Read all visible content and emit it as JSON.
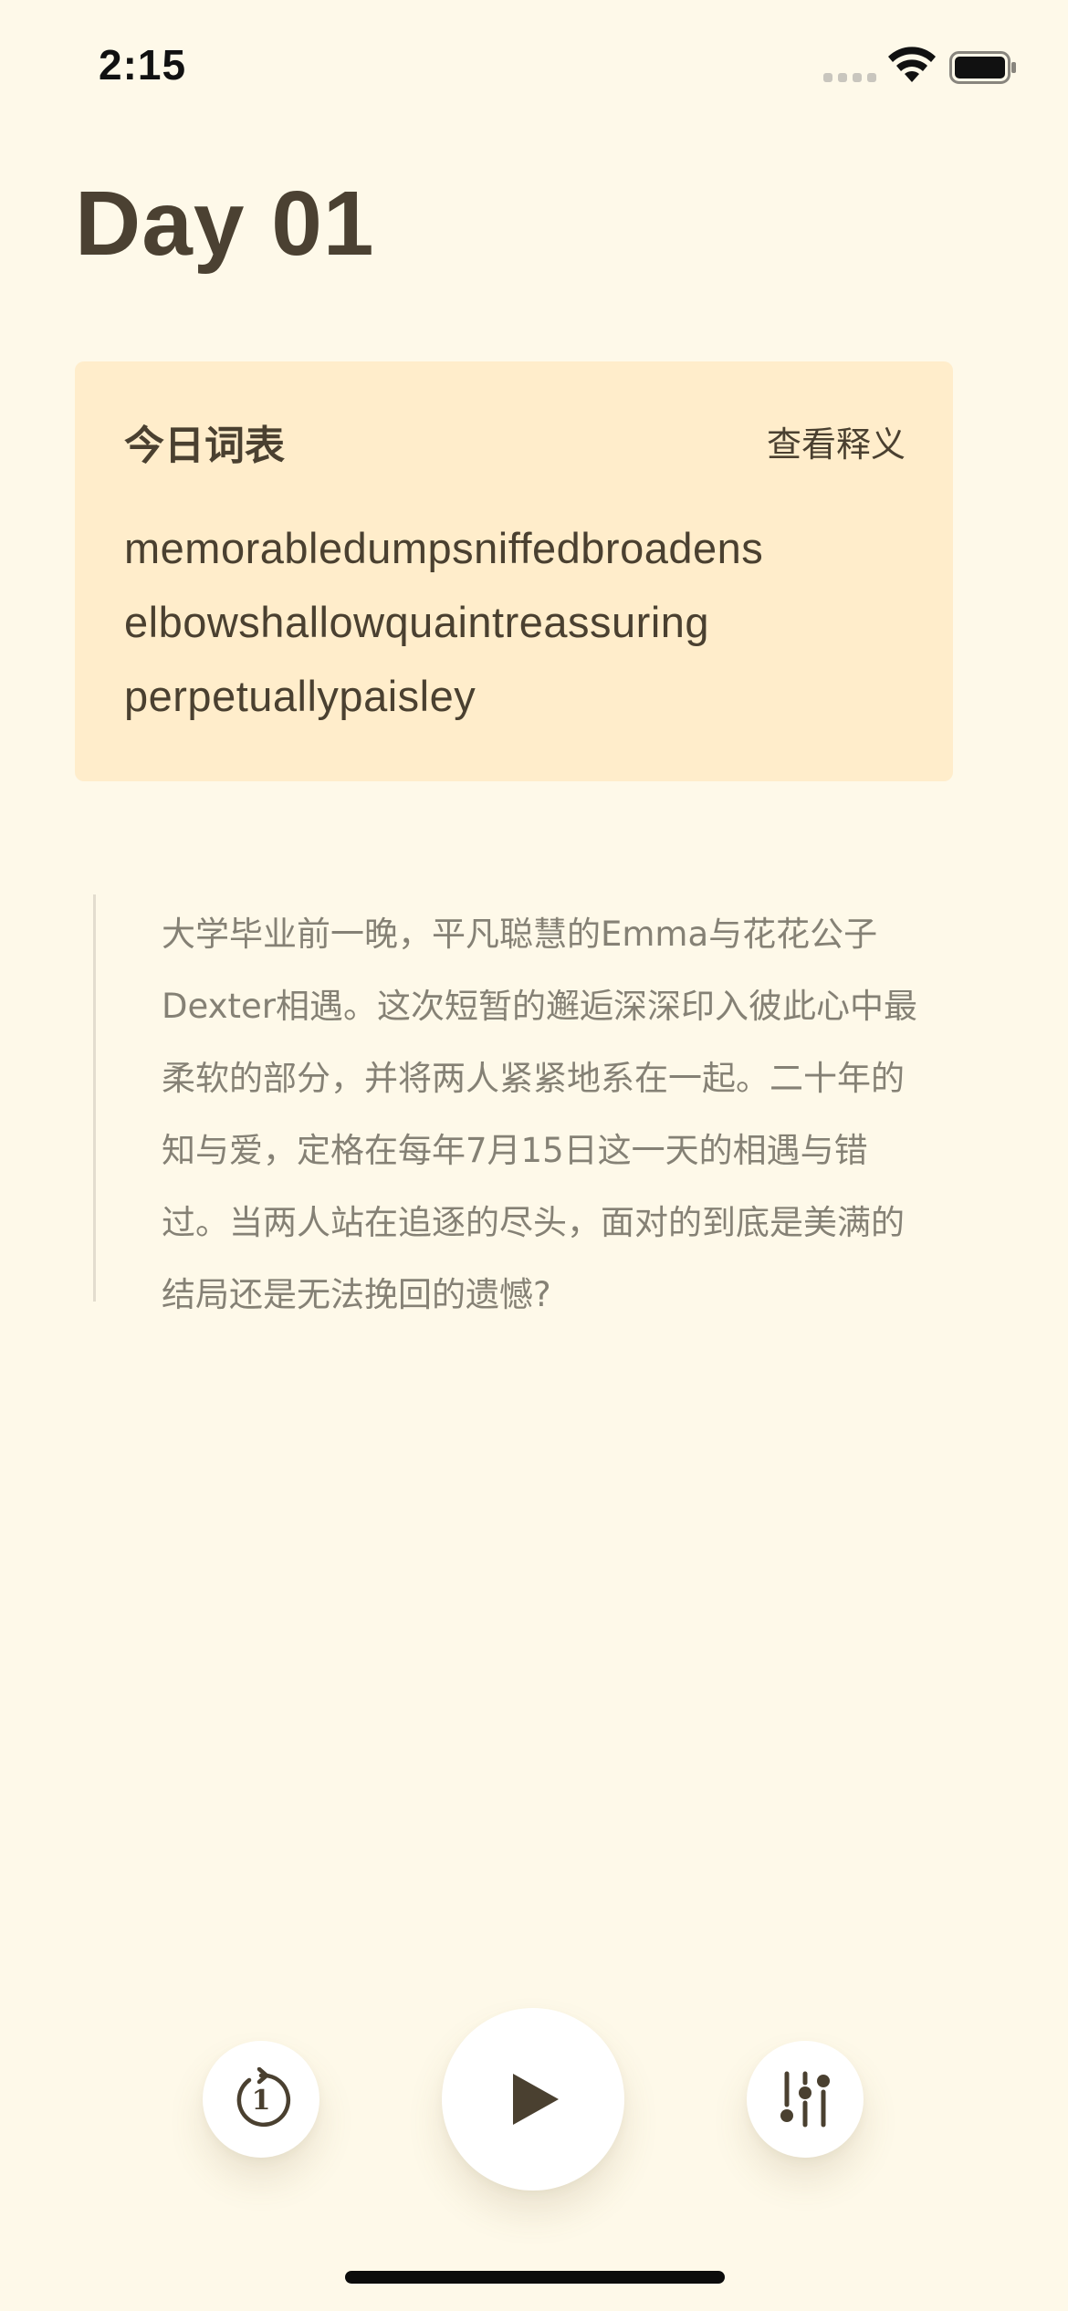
{
  "status_bar": {
    "time": "2:15"
  },
  "page": {
    "title": "Day 01"
  },
  "word_card": {
    "title": "今日词表",
    "link_label": "查看释义",
    "word_lines": [
      "memorabledumpsniffedbroadens",
      "elbowshallowquaintreassuring",
      "perpetuallypaisley"
    ]
  },
  "quote": {
    "lines": [
      "大学毕业前一晚，平凡聪慧的Emma与花花公子",
      "Dexter相遇。这次短暂的邂逅深深印入彼此心中最",
      "柔软的部分，并将两人紧紧地系在一起。二十年的",
      "知与爱，定格在每年7月15日这一天的相遇与错",
      "过。当两人站在追逐的尽头，面对的到底是美满的",
      "结局还是无法挽回的遗憾?"
    ]
  },
  "controls": {
    "replay_icon": "replay-1-icon",
    "replay_number": "1",
    "play_icon": "play-icon",
    "settings_icon": "sliders-icon"
  },
  "colors": {
    "background": "#FEF9E9",
    "card_background": "#FFEDCB",
    "primary_text": "#4A4030",
    "secondary_text": "#858175"
  }
}
